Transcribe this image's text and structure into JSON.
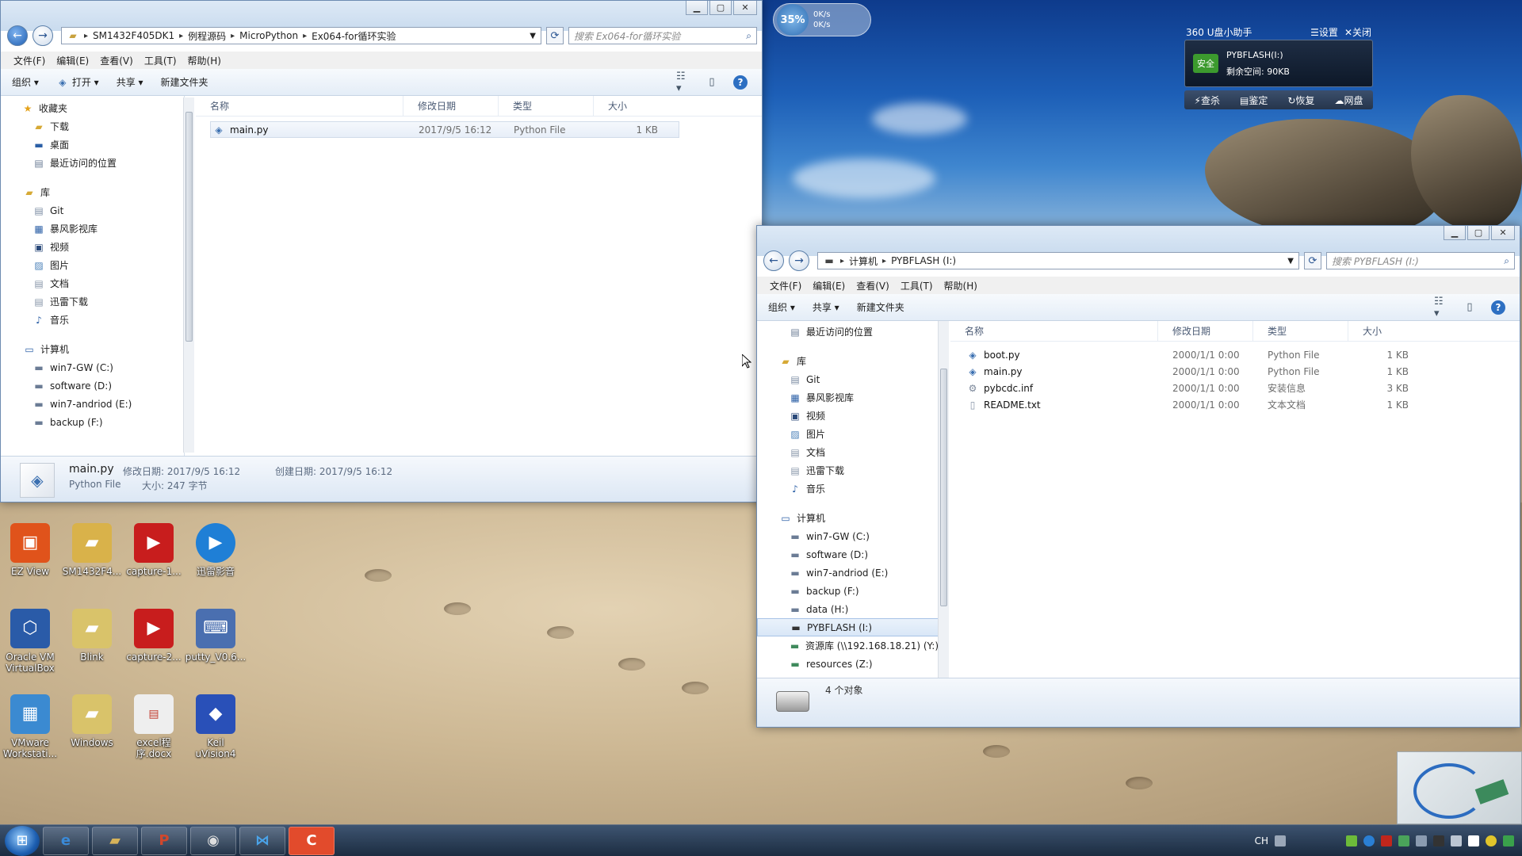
{
  "netmeter": {
    "percent": "35%",
    "up": "0K/s",
    "down": "0K/s"
  },
  "usb_widget": {
    "title": "360 U盘小助手",
    "settings": "☰设置",
    "close": "✕关闭",
    "badge": "安全",
    "drive": "PYBFLASH(I:)",
    "free": "剩余空间: 90KB",
    "actions": [
      "⚡查杀",
      "▤鉴定",
      "↻恢复",
      "☁网盘"
    ]
  },
  "win1": {
    "address": [
      "SM1432F405DK1",
      "例程源码",
      "MicroPython",
      "Ex064-for循环实验"
    ],
    "search_placeholder": "搜索 Ex064-for循环实验",
    "menu": [
      "文件(F)",
      "编辑(E)",
      "查看(V)",
      "工具(T)",
      "帮助(H)"
    ],
    "toolbar": {
      "organize": "组织 ▾",
      "open": "打开 ▾",
      "share": "共享 ▾",
      "newfolder": "新建文件夹"
    },
    "favorites": {
      "label": "收藏夹",
      "items": [
        "下载",
        "桌面",
        "最近访问的位置"
      ]
    },
    "library": {
      "label": "库",
      "items": [
        "Git",
        "暴风影视库",
        "视频",
        "图片",
        "文档",
        "迅雷下载",
        "音乐"
      ]
    },
    "computer": {
      "label": "计算机",
      "items": [
        "win7-GW (C:)",
        "software (D:)",
        "win7-andriod (E:)",
        "backup (F:)"
      ]
    },
    "columns": [
      "名称",
      "修改日期",
      "类型",
      "大小"
    ],
    "files": [
      {
        "name": "main.py",
        "date": "2017/9/5 16:12",
        "type": "Python File",
        "size": "1 KB"
      }
    ],
    "status": {
      "name": "main.py",
      "type": "Python File",
      "modified_label": "修改日期: 2017/9/5 16:12",
      "created_label": "创建日期: 2017/9/5 16:12",
      "size_label": "大小: 247 字节"
    }
  },
  "win2": {
    "address": [
      "计算机",
      "PYBFLASH (I:)"
    ],
    "search_placeholder": "搜索 PYBFLASH (I:)",
    "menu": [
      "文件(F)",
      "编辑(E)",
      "查看(V)",
      "工具(T)",
      "帮助(H)"
    ],
    "toolbar": {
      "organize": "组织 ▾",
      "share": "共享 ▾",
      "newfolder": "新建文件夹"
    },
    "recent": "最近访问的位置",
    "library": {
      "label": "库",
      "items": [
        "Git",
        "暴风影视库",
        "视频",
        "图片",
        "文档",
        "迅雷下载",
        "音乐"
      ]
    },
    "computer": {
      "label": "计算机",
      "items": [
        "win7-GW (C:)",
        "software (D:)",
        "win7-andriod (E:)",
        "backup (F:)",
        "data (H:)",
        "PYBFLASH (I:)",
        "资源库 (\\\\192.168.18.21) (Y:)",
        "resources (Z:)"
      ]
    },
    "columns": [
      "名称",
      "修改日期",
      "类型",
      "大小"
    ],
    "files": [
      {
        "name": "boot.py",
        "date": "2000/1/1 0:00",
        "type": "Python File",
        "size": "1 KB"
      },
      {
        "name": "main.py",
        "date": "2000/1/1 0:00",
        "type": "Python File",
        "size": "1 KB"
      },
      {
        "name": "pybcdc.inf",
        "date": "2000/1/1 0:00",
        "type": "安装信息",
        "size": "3 KB"
      },
      {
        "name": "README.txt",
        "date": "2000/1/1 0:00",
        "type": "文本文档",
        "size": "1 KB"
      }
    ],
    "status": "4 个对象"
  },
  "desktop": [
    {
      "label": "EZ View",
      "icon": "ez-view-icon",
      "color": "#e0531b"
    },
    {
      "label": "SM1432F4...",
      "icon": "folder-icon",
      "color": "#d9b24a"
    },
    {
      "label": "capture-1...",
      "icon": "video-icon",
      "color": "#c81d1d"
    },
    {
      "label": "迅雷影音",
      "icon": "xunlei-player-icon",
      "color": "#1f7fd6"
    },
    {
      "label": "Oracle VM VirtualBox",
      "icon": "virtualbox-icon",
      "color": "#2a5ba8"
    },
    {
      "label": "Blink",
      "icon": "folder-icon",
      "color": "#d9c36a"
    },
    {
      "label": "capture-2...",
      "icon": "video-icon",
      "color": "#c81d1d"
    },
    {
      "label": "putty_V0.6...",
      "icon": "putty-icon",
      "color": "#4a6fb0"
    },
    {
      "label": "VMware Workstati...",
      "icon": "vmware-icon",
      "color": "#3b8ad1"
    },
    {
      "label": "Windows",
      "icon": "folder-icon",
      "color": "#d9c36a"
    },
    {
      "label": "excel程序.docx",
      "icon": "pdf-doc-icon",
      "color": "#eeeeee"
    },
    {
      "label": "Keil uVision4",
      "icon": "keil-icon",
      "color": "#2950b8"
    }
  ],
  "tray": {
    "lang": "CH"
  }
}
